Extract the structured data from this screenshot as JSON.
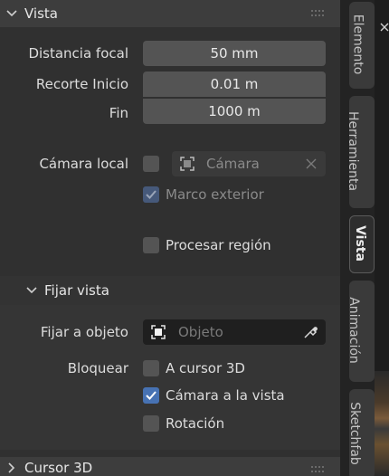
{
  "vista": {
    "header": "Vista",
    "distancia_focal": {
      "label": "Distancia focal",
      "value": "50 mm"
    },
    "recorte_inicio": {
      "label": "Recorte  Inicio",
      "value": "0.01 m"
    },
    "fin": {
      "label": "Fin",
      "value": "1000 m"
    },
    "camara_local": {
      "label": "Cámara local",
      "placeholder": "Cámara"
    },
    "marco_exterior": {
      "label": "Marco exterior",
      "checked": true,
      "disabled": true
    },
    "procesar_region": {
      "label": "Procesar región",
      "checked": false
    }
  },
  "fijar_vista": {
    "header": "Fijar vista",
    "fijar_objeto": {
      "label": "Fijar a objeto",
      "placeholder": "Objeto"
    },
    "bloquear": {
      "label": "Bloquear",
      "items": [
        {
          "label": "A cursor 3D",
          "checked": false
        },
        {
          "label": "Cámara a la vista",
          "checked": true
        },
        {
          "label": "Rotación",
          "checked": false
        }
      ]
    }
  },
  "cursor3d": {
    "header": "Cursor 3D"
  },
  "tabs": [
    "Elemento",
    "Herramienta",
    "Vista",
    "Animación",
    "Sketchfab"
  ],
  "active_tab": "Vista",
  "colors": {
    "accent": "#4772b3",
    "field": "#545454",
    "panel": "#303030",
    "header": "#3d3d3d"
  }
}
